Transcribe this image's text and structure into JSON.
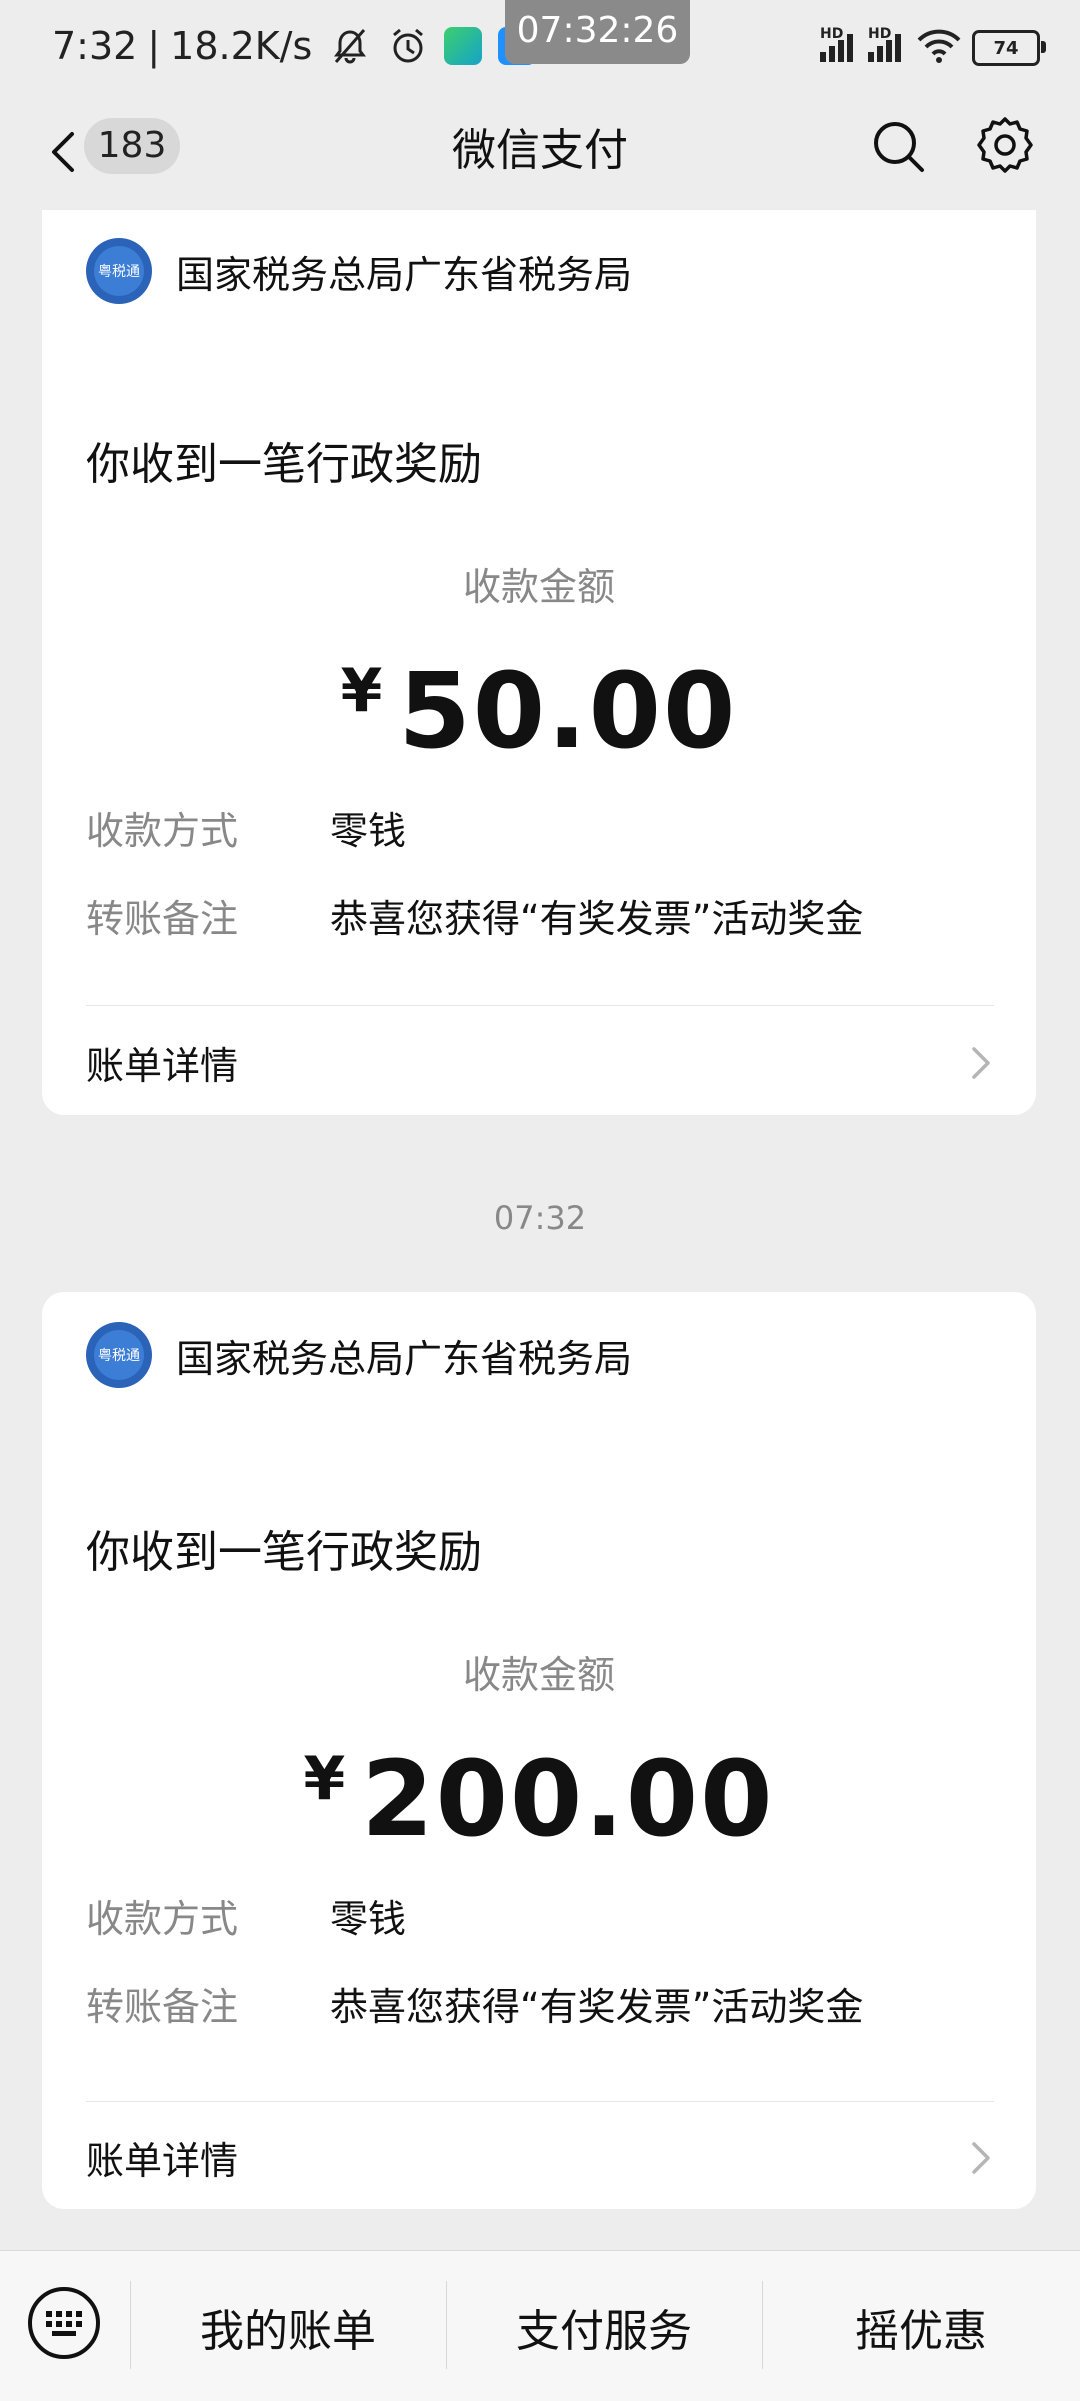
{
  "status_bar": {
    "time": "7:32",
    "network_speed": "18.2K/s",
    "clock_overlay": "07:32:26",
    "signal_label_1": "HD",
    "signal_label_2": "HD",
    "battery": "74",
    "icons": [
      "mute-icon",
      "alarm-icon",
      "app-icon",
      "upload-icon",
      "signal-icon",
      "signal-icon",
      "wifi-icon",
      "battery-icon"
    ]
  },
  "header": {
    "unread_count": "183",
    "title": "微信支付",
    "icons": [
      "back-icon",
      "search-icon",
      "settings-icon"
    ]
  },
  "messages": [
    {
      "sender": "国家税务总局广东省税务局",
      "title": "你收到一笔行政奖励",
      "amount_label": "收款金额",
      "currency_symbol": "¥",
      "amount": "50.00",
      "method_label": "收款方式",
      "method_value": "零钱",
      "note_label": "转账备注",
      "note_value": "恭喜您获得“有奖发票”活动奖金",
      "bill_details": "账单详情"
    },
    {
      "timestamp": "07:32",
      "sender": "国家税务总局广东省税务局",
      "title": "你收到一笔行政奖励",
      "amount_label": "收款金额",
      "currency_symbol": "¥",
      "amount": "200.00",
      "method_label": "收款方式",
      "method_value": "零钱",
      "note_label": "转账备注",
      "note_value": "恭喜您获得“有奖发票”活动奖金",
      "bill_details": "账单详情"
    }
  ],
  "bottom_menu": {
    "items": [
      "我的账单",
      "支付服务",
      "摇优惠"
    ],
    "icons": [
      "keyboard-icon"
    ]
  }
}
